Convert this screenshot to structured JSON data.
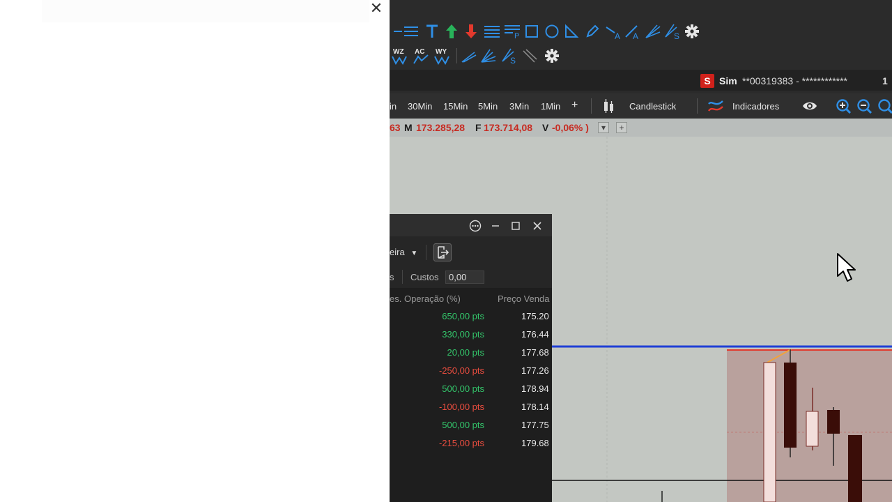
{
  "left_panel": {
    "close_glyph": "✕"
  },
  "account": {
    "badge": "S",
    "mode": "Sim",
    "number": "**00319383 - ************",
    "extra": "1"
  },
  "timeframes": [
    {
      "label": "in"
    },
    {
      "label": "30Min"
    },
    {
      "label": "15Min"
    },
    {
      "label": "5Min"
    },
    {
      "label": "3Min"
    },
    {
      "label": "1Min"
    },
    {
      "label": "+"
    }
  ],
  "chart_type": {
    "label": "Candlestick"
  },
  "indicators": {
    "label": "Indicadores"
  },
  "toolbar2_labels": {
    "wz": "WZ",
    "ac": "AC",
    "wy": "WY"
  },
  "infobar": {
    "prefix": "63",
    "m_label": "M",
    "m_value": "173.285,28",
    "f_label": "F",
    "f_value": "173.714,08",
    "v_label": "V",
    "v_value": "-0,06% )",
    "btn_down": "▾",
    "btn_add": "+"
  },
  "orders_panel": {
    "account_label": "eira",
    "filter_left": "s",
    "custos_label": "Custos",
    "custos_value": "0,00",
    "col_result": "es. Operação (%)",
    "col_sell_price": "Preço Venda",
    "rows": [
      {
        "result": "650,00 pts",
        "sell_price": "175.20",
        "sign": "pos"
      },
      {
        "result": "330,00 pts",
        "sell_price": "176.44",
        "sign": "pos"
      },
      {
        "result": "20,00 pts",
        "sell_price": "177.68",
        "sign": "pos"
      },
      {
        "result": "-250,00 pts",
        "sell_price": "177.26",
        "sign": "neg"
      },
      {
        "result": "500,00 pts",
        "sell_price": "178.94",
        "sign": "pos"
      },
      {
        "result": "-100,00 pts",
        "sell_price": "178.14",
        "sign": "neg"
      },
      {
        "result": "500,00 pts",
        "sell_price": "177.75",
        "sign": "pos"
      },
      {
        "result": "-215,00 pts",
        "sell_price": "179.68",
        "sign": "neg"
      }
    ]
  },
  "colors": {
    "positive": "#33c46a",
    "negative": "#ea4d3f",
    "price_line": "#1f3fd6",
    "brand_red": "#d0211b"
  }
}
